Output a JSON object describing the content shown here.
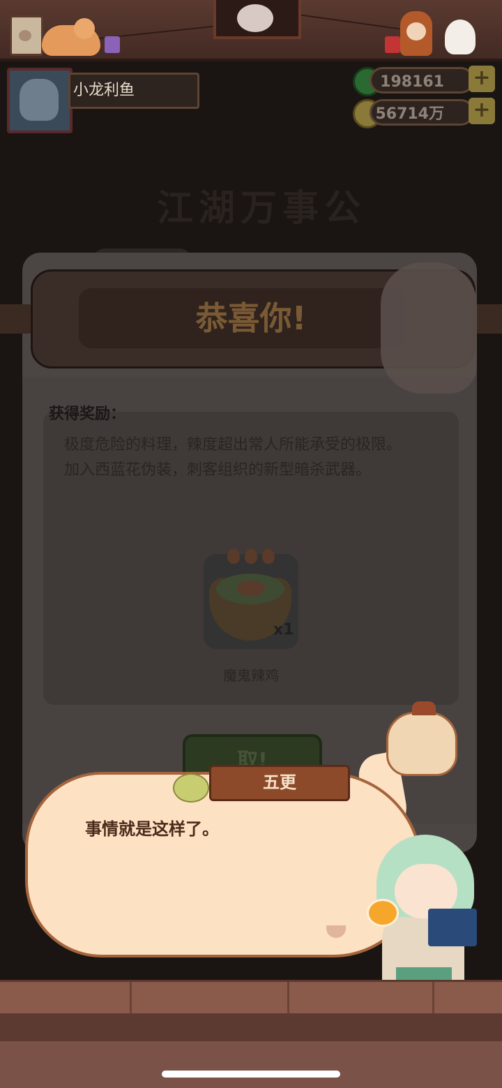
{
  "header": {
    "player_name": "小龙利鱼",
    "jade_amount": "198161",
    "coin_amount": "56714万",
    "add_symbol": "+"
  },
  "background": {
    "title": "江湖万事公"
  },
  "popup": {
    "title": "恭喜你!",
    "reward_label": "获得奖励：",
    "description_line1": "极度危险的料理，辣度超出常人所能承受的极限。",
    "description_line2": "加入西蓝花伪装，刺客组织的新型暗杀武器。",
    "item": {
      "name": "魔鬼辣鸡",
      "quantity": "x1",
      "spice_level": 3
    },
    "confirm_button": "取!"
  },
  "dialog": {
    "speaker": "五更",
    "text": "事情就是这样了。"
  }
}
